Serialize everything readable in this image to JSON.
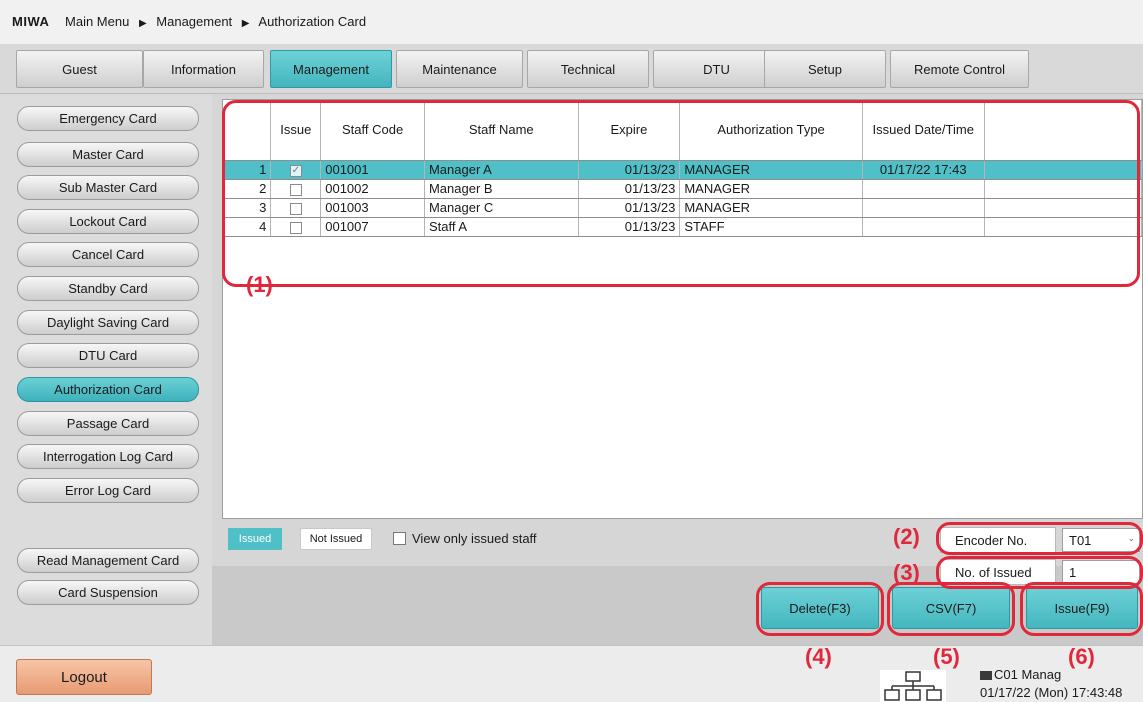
{
  "breadcrumb": {
    "brand": "MIWA",
    "items": [
      "Main Menu",
      "Management",
      "Authorization Card"
    ],
    "separator": "▶"
  },
  "tabs": [
    "Guest",
    "Information",
    "Management",
    "Maintenance",
    "Technical",
    "DTU",
    "Setup",
    "Remote Control"
  ],
  "active_tab": "Management",
  "sidebar": {
    "items": [
      "Emergency Card",
      "Master Card",
      "Sub Master Card",
      "Lockout Card",
      "Cancel Card",
      "Standby Card",
      "Daylight Saving Card",
      "DTU Card",
      "Authorization Card",
      "Passage Card",
      "Interrogation Log Card",
      "Error Log Card"
    ],
    "active": "Authorization Card",
    "extra_items": [
      "Read Management Card",
      "Card Suspension"
    ]
  },
  "table": {
    "columns": [
      "Issue",
      "Staff Code",
      "Staff Name",
      "Expire",
      "Authorization Type",
      "Issued Date/Time"
    ],
    "rows": [
      {
        "num": "1",
        "issue_mark": "✓",
        "code": "001001",
        "name": "Manager A",
        "expire": "01/13/23",
        "type": "MANAGER",
        "issued": "01/17/22 17:43"
      },
      {
        "num": "2",
        "issue_mark": "",
        "code": "001002",
        "name": "Manager B",
        "expire": "01/13/23",
        "type": "MANAGER",
        "issued": ""
      },
      {
        "num": "3",
        "issue_mark": "",
        "code": "001003",
        "name": "Manager C",
        "expire": "01/13/23",
        "type": "MANAGER",
        "issued": ""
      },
      {
        "num": "4",
        "issue_mark": "",
        "code": "001007",
        "name": "Staff A",
        "expire": "01/13/23",
        "type": "STAFF",
        "issued": ""
      }
    ]
  },
  "legend": {
    "issued": "Issued",
    "not_issued": "Not Issued",
    "view_only": "View only issued staff"
  },
  "encoder": {
    "label": "Encoder No.",
    "value": "T01"
  },
  "issued_count": {
    "label": "No. of Issued",
    "value": "1"
  },
  "actions": {
    "delete": "Delete(F3)",
    "csv": "CSV(F7)",
    "issue": "Issue(F9)"
  },
  "logout": "Logout",
  "status": {
    "terminal": "C01 Manag",
    "datetime": "01/17/22 (Mon) 17:43:48"
  },
  "callouts": [
    "(1)",
    "(2)",
    "(3)",
    "(4)",
    "(5)",
    "(6)"
  ],
  "colors": {
    "accent": "#4fc0c8",
    "callout": "#e0283a",
    "logout": "#e9a07a"
  }
}
